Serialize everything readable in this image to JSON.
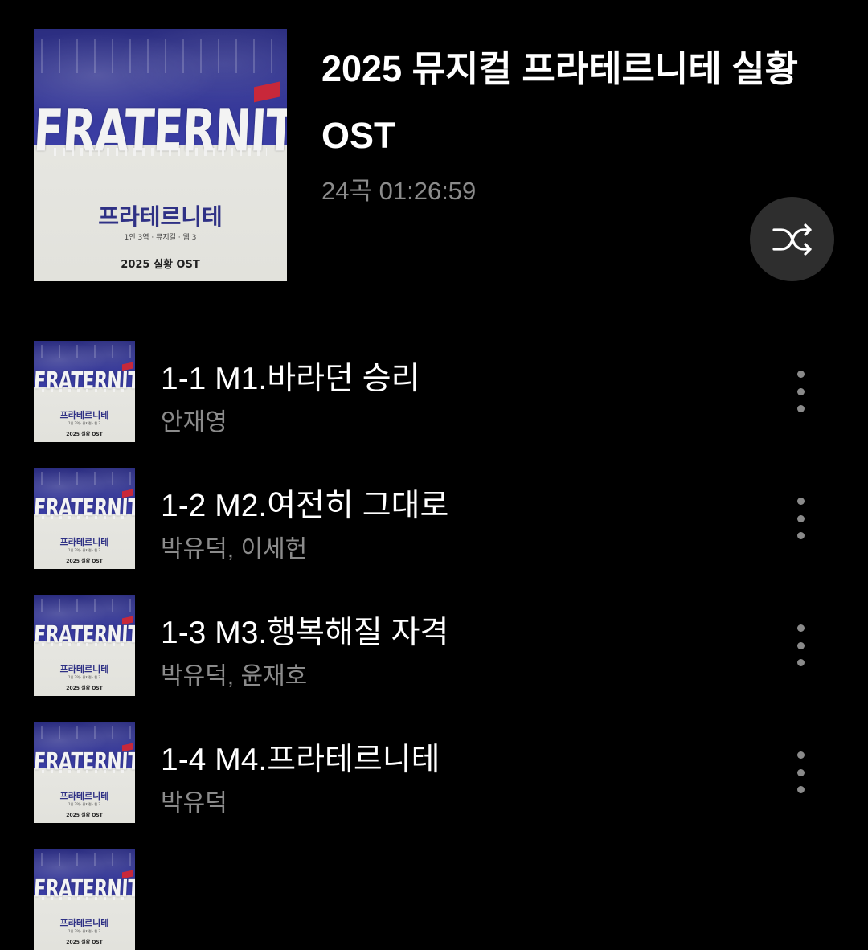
{
  "album": {
    "title": "2025 뮤지컬 프라테르니테 실황 OST",
    "meta": "24곡 01:26:59",
    "cover": {
      "wordmark": "FRATERNITE",
      "korean_title": "프라테르니테",
      "small_text": "1인 3역 · 뮤지컬 · 웹 3",
      "ost_line": "2025 실황 OST"
    }
  },
  "shuffle": {
    "icon": "shuffle-icon"
  },
  "tracks": [
    {
      "title": "1-1 M1.바라던 승리",
      "artist": "안재영"
    },
    {
      "title": "1-2 M2.여전히 그대로",
      "artist": "박유덕, 이세헌"
    },
    {
      "title": "1-3 M3.행복해질 자격",
      "artist": "박유덕, 윤재호"
    },
    {
      "title": "1-4 M4.프라테르니테",
      "artist": "박유덕"
    },
    {
      "title": "",
      "artist": ""
    }
  ],
  "icons": {
    "more": "more-vertical-icon"
  }
}
